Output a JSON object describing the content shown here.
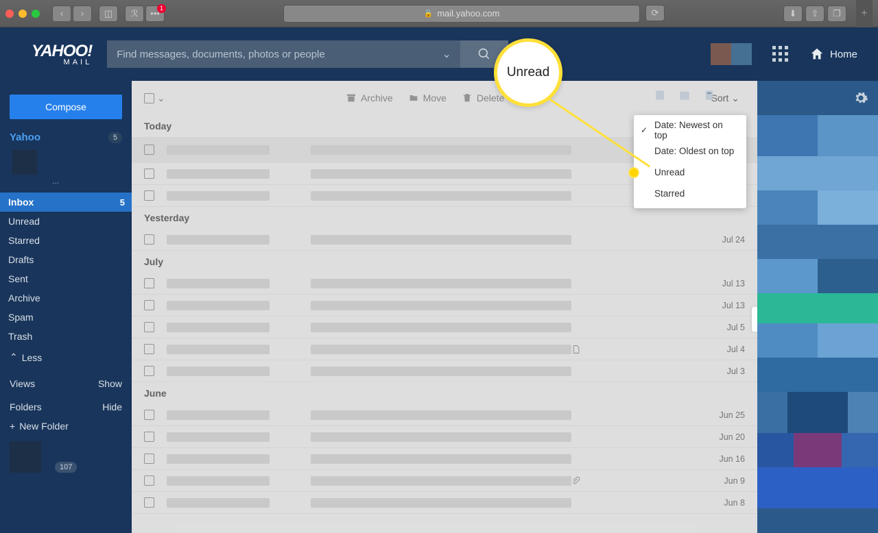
{
  "browser": {
    "url": "mail.yahoo.com",
    "badge": "1"
  },
  "logo": {
    "main": "YAHOO!",
    "sub": "MAIL"
  },
  "search": {
    "placeholder": "Find messages, documents, photos or people"
  },
  "home": {
    "label": "Home"
  },
  "compose": {
    "label": "Compose"
  },
  "account": {
    "name": "Yahoo",
    "count": "5",
    "dots": "..."
  },
  "folders": [
    {
      "label": "Inbox",
      "count": "5",
      "active": true
    },
    {
      "label": "Unread"
    },
    {
      "label": "Starred"
    },
    {
      "label": "Drafts"
    },
    {
      "label": "Sent"
    },
    {
      "label": "Archive"
    },
    {
      "label": "Spam"
    },
    {
      "label": "Trash"
    }
  ],
  "less": "Less",
  "views": {
    "label": "Views",
    "action": "Show"
  },
  "folders_section": {
    "label": "Folders",
    "action": "Hide"
  },
  "new_folder": "New Folder",
  "side_count": "107",
  "toolbar": {
    "archive": "Archive",
    "move": "Move",
    "delete": "Delete",
    "sort": "Sort"
  },
  "sort_menu": [
    {
      "label": "Date: Newest on top",
      "checked": true
    },
    {
      "label": "Date: Oldest on top"
    },
    {
      "label": "Unread",
      "highlight": true
    },
    {
      "label": "Starred"
    }
  ],
  "groups": [
    {
      "header": "Today",
      "rows": [
        {
          "highlight": true
        },
        {},
        {}
      ]
    },
    {
      "header": "Yesterday",
      "rows": [
        {
          "date": "Jul 24"
        }
      ]
    },
    {
      "header": "July",
      "rows": [
        {
          "date": "Jul 13"
        },
        {
          "date": "Jul 13"
        },
        {
          "date": "Jul 5"
        },
        {
          "date": "Jul 4",
          "file": true
        },
        {
          "date": "Jul 3"
        }
      ]
    },
    {
      "header": "June",
      "rows": [
        {
          "date": "Jun 25"
        },
        {
          "date": "Jun 20"
        },
        {
          "date": "Jun 16"
        },
        {
          "date": "Jun 9",
          "attach": true
        },
        {
          "date": "Jun 8"
        }
      ]
    }
  ],
  "callout": {
    "label": "Unread"
  }
}
